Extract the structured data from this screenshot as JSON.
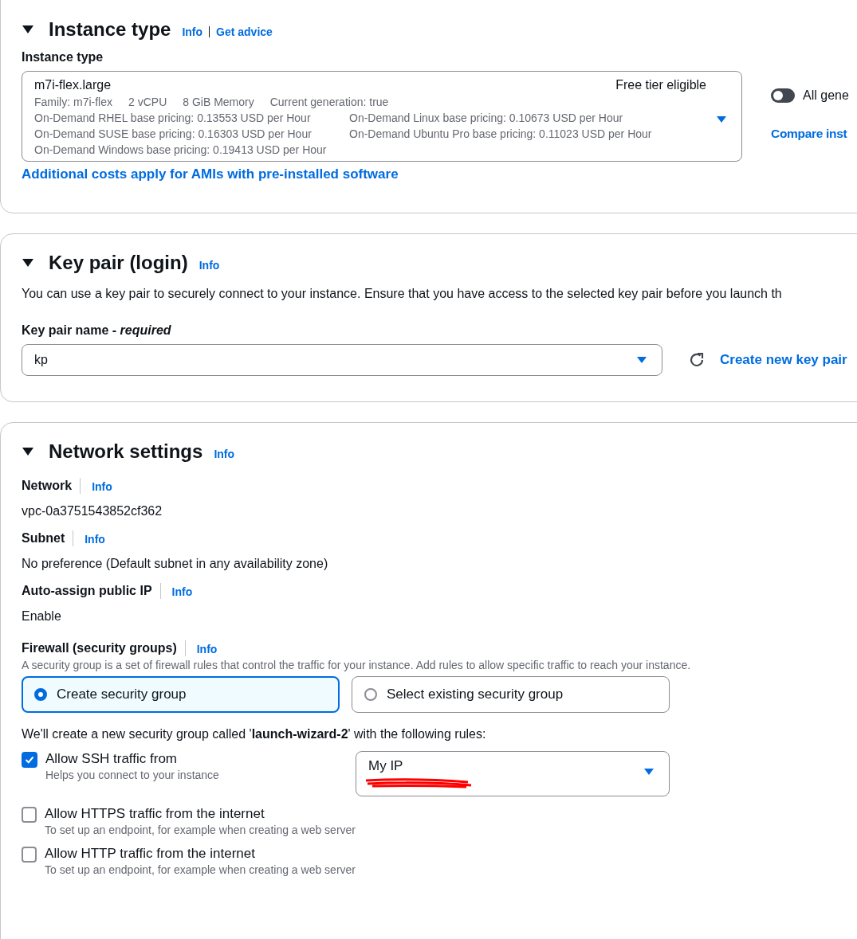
{
  "instance_type": {
    "title": "Instance type",
    "expanded": true,
    "info": "Info",
    "advice": "Get advice",
    "field_label": "Instance type",
    "selected_type": {
      "name": "m7i-flex.large",
      "badge": "Free tier eligible",
      "specs": [
        "Family: m7i-flex",
        "2 vCPU",
        "8 GiB Memory",
        "Current generation: true"
      ],
      "pricing": [
        [
          "On-Demand RHEL base pricing: 0.13553 USD per Hour",
          "On-Demand Linux base pricing: 0.10673 USD per Hour"
        ],
        [
          "On-Demand SUSE base pricing: 0.16303 USD per Hour",
          "On-Demand Ubuntu Pro base pricing: 0.11023 USD per Hour"
        ],
        [
          "On-Demand Windows base pricing: 0.19413 USD per Hour"
        ]
      ]
    },
    "toggle": {
      "label": "All gene",
      "on": false
    },
    "compare_link": "Compare inst",
    "costs_link": "Additional costs apply for AMIs with pre-installed software"
  },
  "key_pair": {
    "title": "Key pair (login)",
    "expanded": true,
    "info": "Info",
    "description": "You can use a key pair to securely connect to your instance. Ensure that you have access to the selected key pair before you launch th",
    "field_label": "Key pair name - *required*",
    "value": "kp",
    "create_link": "Create new key pair"
  },
  "network": {
    "title": "Network settings",
    "expanded": true,
    "info": "Info",
    "fields": [
      {
        "label": "Network",
        "info": "Info",
        "value": "vpc-0a3751543852cf362"
      },
      {
        "label": "Subnet",
        "info": "Info",
        "value": "No preference (Default subnet in any availability zone)"
      },
      {
        "label": "Auto-assign public IP",
        "info": "Info",
        "value": "Enable"
      }
    ],
    "firewall": {
      "label": "Firewall (security groups)",
      "info": "Info",
      "description": "A security group is a set of firewall rules that control the traffic for your instance. Add rules to allow specific traffic to reach your instance.",
      "options": [
        {
          "label": "Create security group",
          "selected": true
        },
        {
          "label": "Select existing security group",
          "selected": false
        }
      ]
    },
    "rules_intro": "We'll create a new security group called '**launch-wizard-2**' with the following rules:",
    "rules": [
      {
        "label": "Allow SSH traffic from",
        "hint": "Helps you connect to your instance",
        "checked": true,
        "source": "My IP"
      },
      {
        "label": "Allow HTTPS traffic from the internet",
        "hint": "To set up an endpoint, for example when creating a web server",
        "checked": false
      },
      {
        "label": "Allow HTTP traffic from the internet",
        "hint": "To set up an endpoint, for example when creating a web server",
        "checked": false
      }
    ]
  }
}
